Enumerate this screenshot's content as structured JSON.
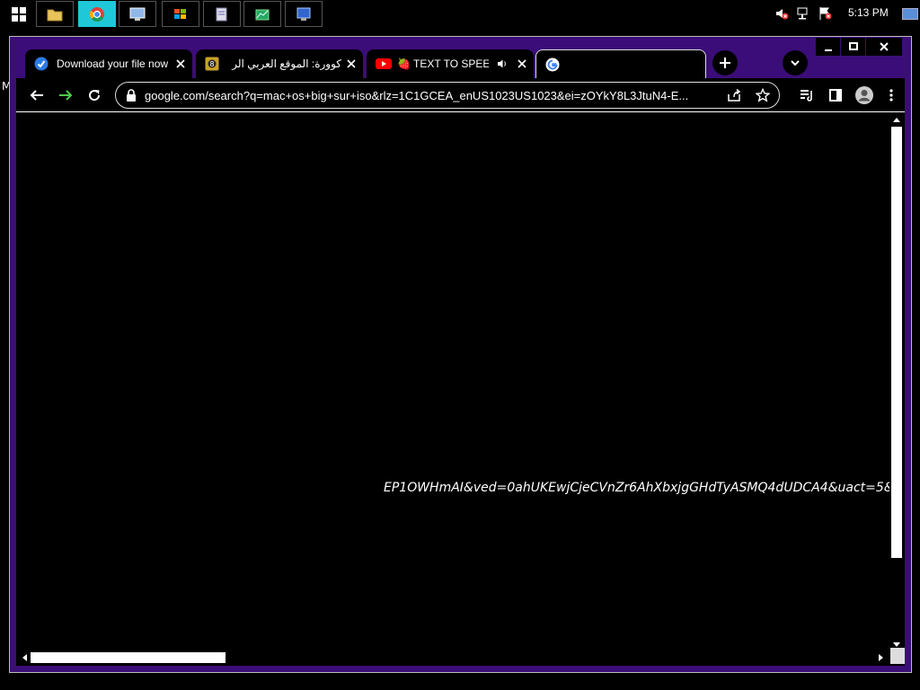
{
  "taskbar": {
    "buttons": [
      "start-button",
      "file-explorer",
      "chrome",
      "network-app",
      "windows-app",
      "documents-app",
      "chart-app",
      "remote-app"
    ],
    "clock": "5:13 PM"
  },
  "desktop": {
    "edge_letter": "M"
  },
  "tabs": [
    {
      "title": "Download your file now",
      "icon": "checkmark-icon"
    },
    {
      "title": "كوورة: الموقع العربي الر",
      "icon": "kooora-icon"
    },
    {
      "title": "🍓 TEXT TO SPEECH",
      "icon": "youtube-icon"
    },
    {
      "title": "",
      "icon": "google-icon",
      "active": true
    }
  ],
  "toolbar": {
    "url": "google.com/search?q=mac+os+big+sur+iso&rlz=1C1GCEA_enUS1023US1023&ei=zOYkY8L3JtuN4-E..."
  },
  "content": {
    "overflow_text": "EP1OWHmAI&ved=0ahUKEwjCjeCVnZr6AhXbxjgGHdTyASMQ4dUDCA4&uact=5&"
  },
  "colors": {
    "frame": "#3b0d78",
    "taskbar_active": "#1ec8d8",
    "forward_arrow": "#4ec94e"
  }
}
